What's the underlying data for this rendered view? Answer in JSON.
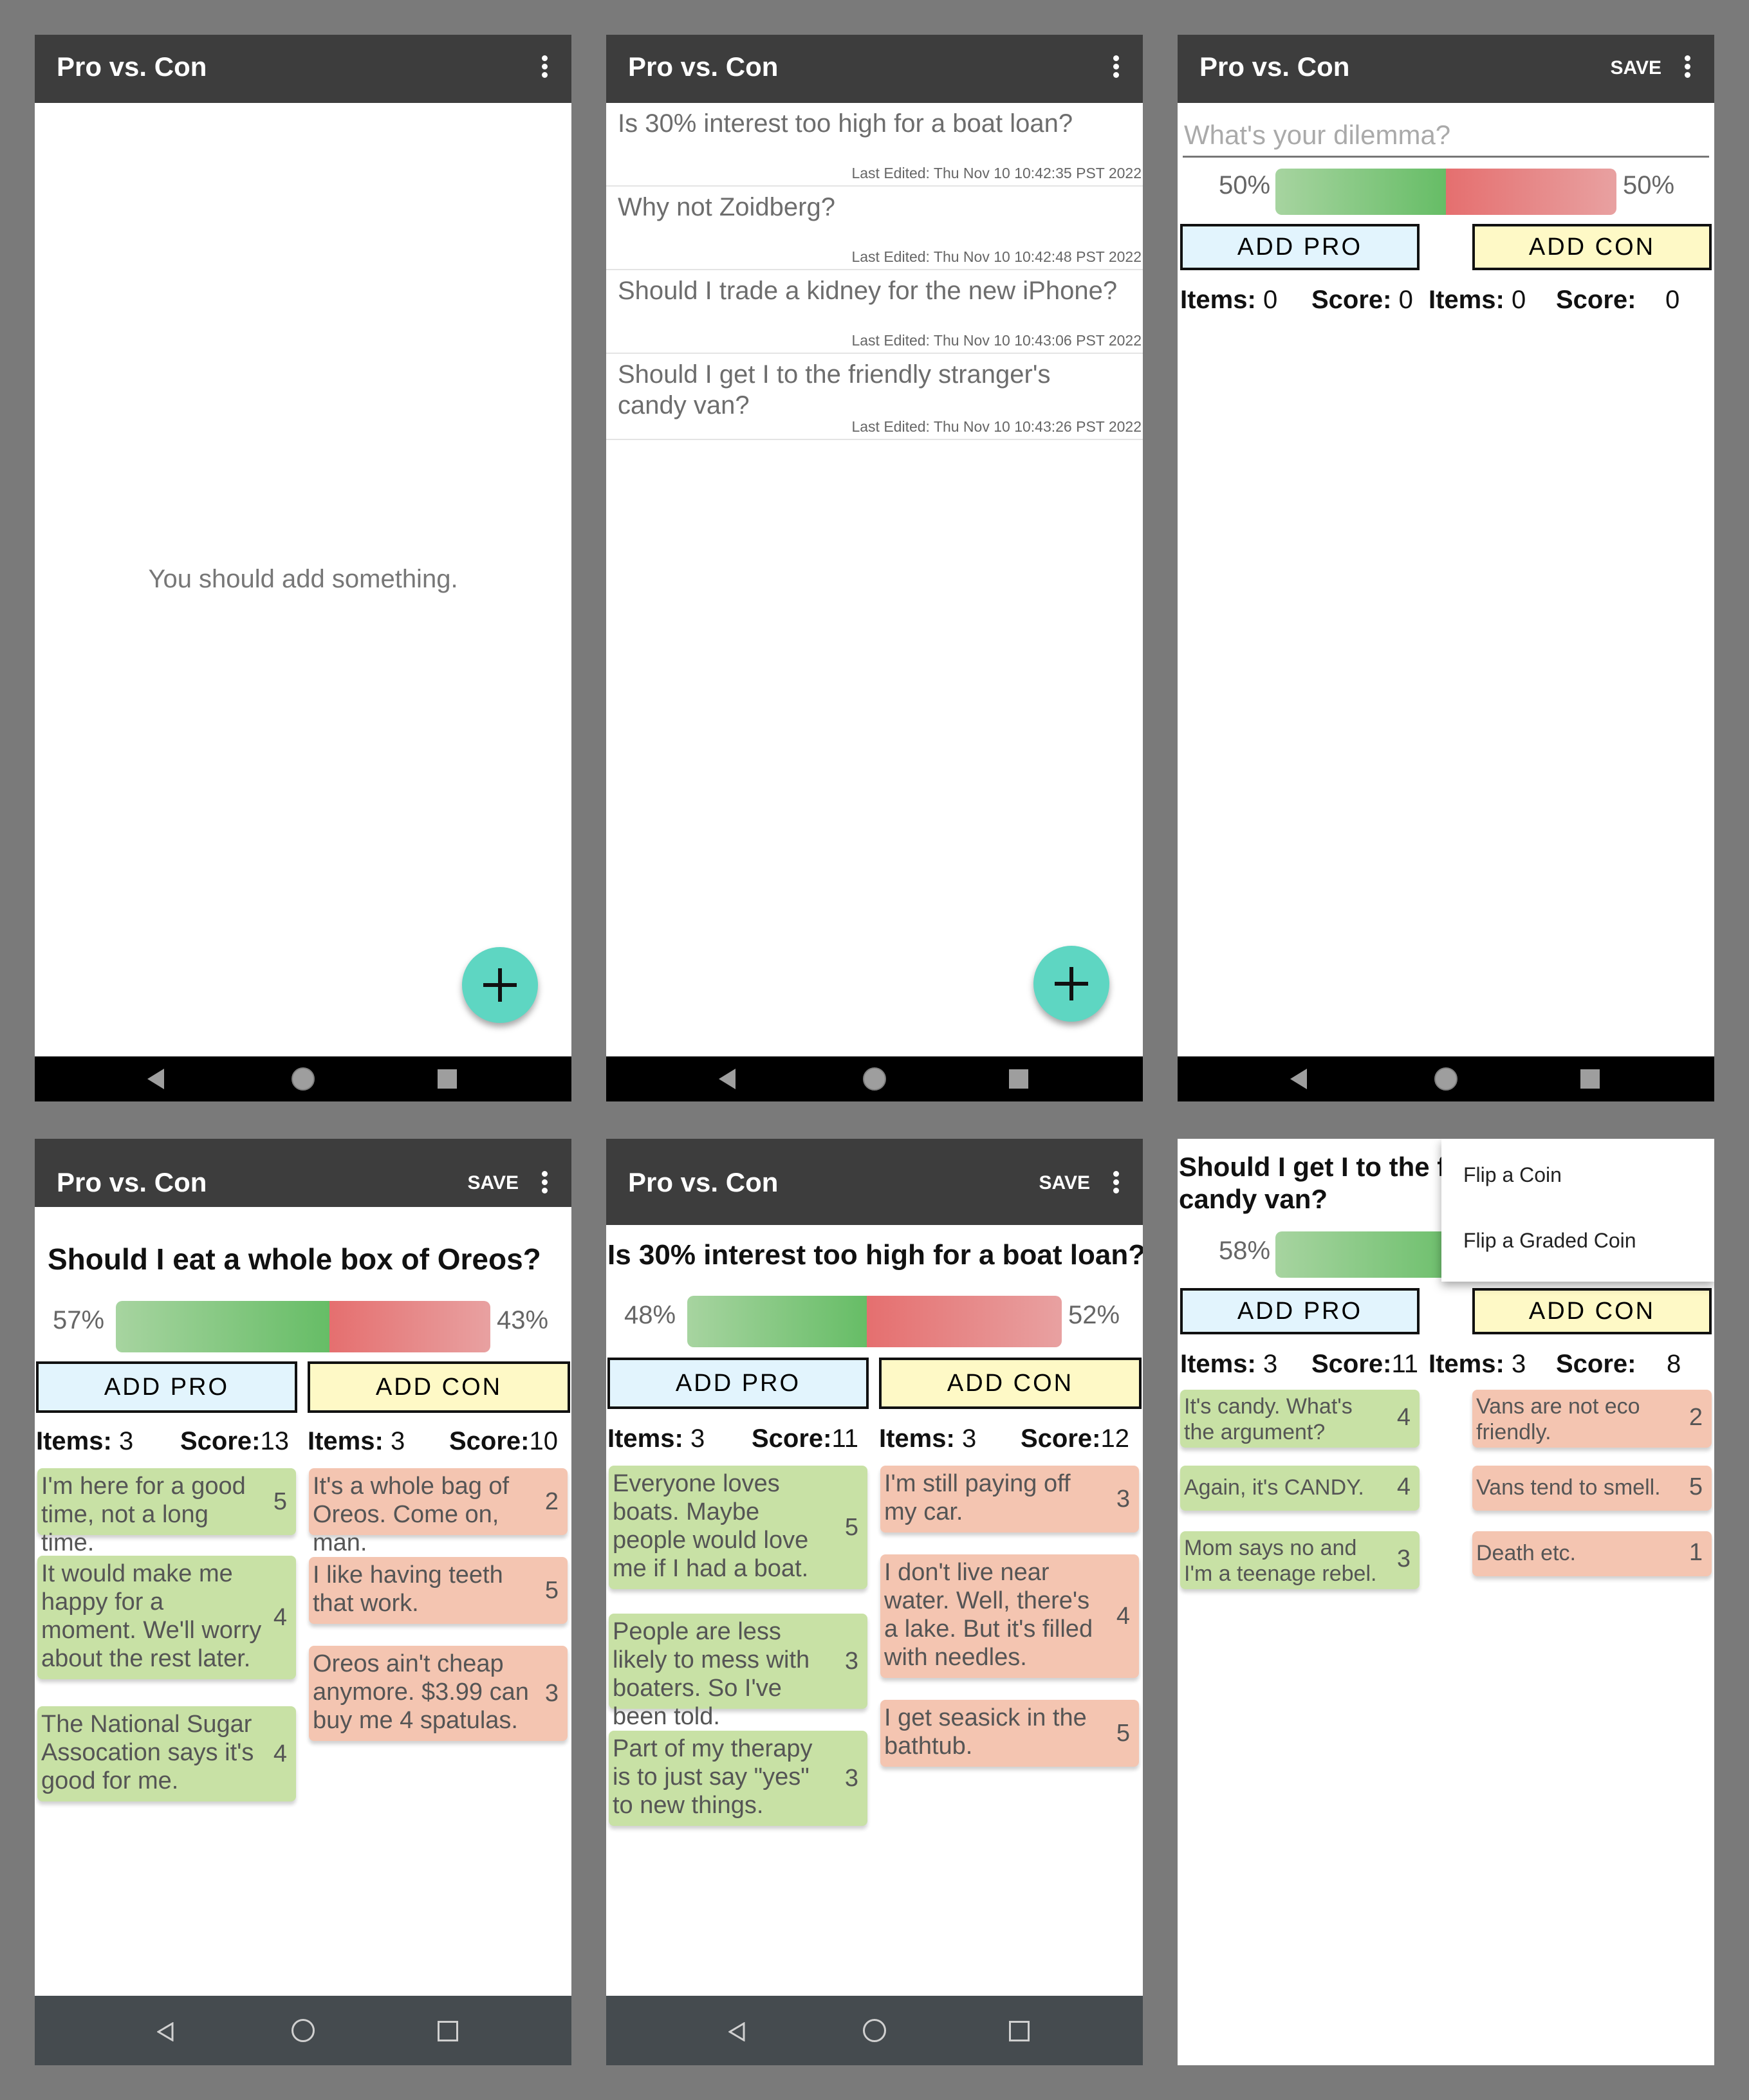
{
  "app_title": "Pro vs. Con",
  "save_label": "SAVE",
  "add_pro": "ADD PRO",
  "add_con": "ADD CON",
  "items_label": "Items:",
  "score_label": "Score:",
  "screen1": {
    "empty_text": "You should add something."
  },
  "screen2": {
    "items": [
      {
        "question": "Is 30% interest too high for a boat loan?",
        "date": "Last Edited: Thu Nov 10 10:42:35 PST 2022"
      },
      {
        "question": "Why not Zoidberg?",
        "date": "Last Edited: Thu Nov 10 10:42:48 PST 2022"
      },
      {
        "question": "Should I trade a kidney for the new iPhone?",
        "date": "Last Edited: Thu Nov 10 10:43:06 PST 2022"
      },
      {
        "question": "Should I get I to the friendly stranger's candy van?",
        "date": "Last Edited: Thu Nov 10 10:43:26 PST 2022"
      }
    ]
  },
  "screen3": {
    "placeholder": "What's your dilemma?",
    "pro_pct": "50%",
    "con_pct": "50%",
    "pro_fraction": 0.5,
    "pro_items": "0",
    "pro_score": "0",
    "con_items": "0",
    "con_score": "0"
  },
  "screen4": {
    "title": "Should I eat a whole box of Oreos?",
    "pro_pct": "57%",
    "con_pct": "43%",
    "pro_fraction": 0.57,
    "pro_items": "3",
    "pro_score": "13",
    "con_items": "3",
    "con_score": "10",
    "pros": [
      {
        "text": "I'm here for a good time, not a long time.",
        "score": "5"
      },
      {
        "text": "It would make me happy for a moment. We'll worry about the rest later.",
        "score": "4"
      },
      {
        "text": "The National Sugar Assocation says it's good for me.",
        "score": "4"
      }
    ],
    "cons": [
      {
        "text": "It's a whole bag of Oreos. Come on, man.",
        "score": "2"
      },
      {
        "text": "I like having teeth that work.",
        "score": "5"
      },
      {
        "text": "Oreos ain't cheap anymore. $3.99 can buy me 4 spatulas.",
        "score": "3"
      }
    ]
  },
  "screen5": {
    "title": "Is 30% interest too high for a boat loan?",
    "pro_pct": "48%",
    "con_pct": "52%",
    "pro_fraction": 0.48,
    "pro_items": "3",
    "pro_score": "11",
    "con_items": "3",
    "con_score": "12",
    "pros": [
      {
        "text": "Everyone loves boats. Maybe people would love me if I had a boat.",
        "score": "5"
      },
      {
        "text": "People are less likely to mess with boaters. So I've been told.",
        "score": "3"
      },
      {
        "text": "Part of my therapy is to just say \"yes\" to new things.",
        "score": "3"
      }
    ],
    "cons": [
      {
        "text": "I'm still paying off my car.",
        "score": "3"
      },
      {
        "text": "I don't live near water. Well, there's a lake. But it's filled with needles.",
        "score": "4"
      },
      {
        "text": "I get seasick in the bathtub.",
        "score": "5"
      }
    ]
  },
  "screen6": {
    "title_line1": "Should I get I to the fr",
    "title_line2": "candy van?",
    "pro_pct": "58%",
    "pro_fraction": 0.58,
    "pro_items": "3",
    "pro_score": "11",
    "con_items": "3",
    "con_score": "8",
    "menu": [
      "Flip a Coin",
      "Flip a Graded Coin"
    ],
    "pros": [
      {
        "text": "It's candy. What's the argument?",
        "score": "4"
      },
      {
        "text": "Again, it's CANDY.",
        "score": "4"
      },
      {
        "text": "Mom says no and I'm a teenage rebel.",
        "score": "3"
      }
    ],
    "cons": [
      {
        "text": "Vans are not eco friendly.",
        "score": "2"
      },
      {
        "text": "Vans tend to smell.",
        "score": "5"
      },
      {
        "text": "Death etc.",
        "score": "1"
      }
    ]
  }
}
